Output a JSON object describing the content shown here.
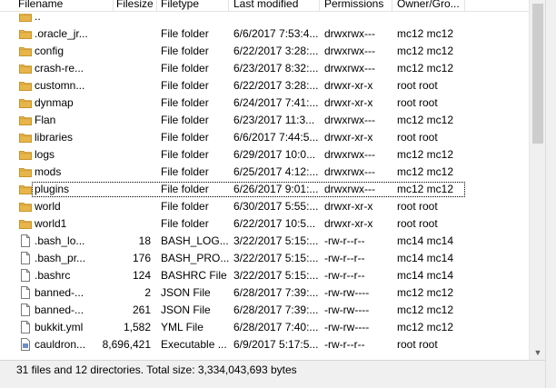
{
  "columns": {
    "filename": "Filename",
    "filesize": "Filesize",
    "filetype": "Filetype",
    "last_modified": "Last modified",
    "permissions": "Permissions",
    "owner": "Owner/Gro..."
  },
  "rows": [
    {
      "name": "..",
      "size": "",
      "type": "",
      "modified": "",
      "perm": "",
      "owner": "",
      "icon": "folder-icon"
    },
    {
      "name": ".oracle_jr...",
      "size": "",
      "type": "File folder",
      "modified": "6/6/2017 7:53:4...",
      "perm": "drwxrwx---",
      "owner": "mc12 mc12",
      "icon": "folder-icon"
    },
    {
      "name": "config",
      "size": "",
      "type": "File folder",
      "modified": "6/22/2017 3:28:...",
      "perm": "drwxrwx---",
      "owner": "mc12 mc12",
      "icon": "folder-icon"
    },
    {
      "name": "crash-re...",
      "size": "",
      "type": "File folder",
      "modified": "6/23/2017 8:32:...",
      "perm": "drwxrwx---",
      "owner": "mc12 mc12",
      "icon": "folder-icon"
    },
    {
      "name": "customn...",
      "size": "",
      "type": "File folder",
      "modified": "6/22/2017 3:28:...",
      "perm": "drwxr-xr-x",
      "owner": "root root",
      "icon": "folder-icon"
    },
    {
      "name": "dynmap",
      "size": "",
      "type": "File folder",
      "modified": "6/24/2017 7:41:...",
      "perm": "drwxr-xr-x",
      "owner": "root root",
      "icon": "folder-icon"
    },
    {
      "name": "Flan",
      "size": "",
      "type": "File folder",
      "modified": "6/23/2017 11:3...",
      "perm": "drwxrwx---",
      "owner": "mc12 mc12",
      "icon": "folder-icon"
    },
    {
      "name": "libraries",
      "size": "",
      "type": "File folder",
      "modified": "6/6/2017 7:44:5...",
      "perm": "drwxr-xr-x",
      "owner": "root root",
      "icon": "folder-icon"
    },
    {
      "name": "logs",
      "size": "",
      "type": "File folder",
      "modified": "6/29/2017 10:0...",
      "perm": "drwxrwx---",
      "owner": "mc12 mc12",
      "icon": "folder-icon"
    },
    {
      "name": "mods",
      "size": "",
      "type": "File folder",
      "modified": "6/25/2017 4:12:...",
      "perm": "drwxrwx---",
      "owner": "mc12 mc12",
      "icon": "folder-icon"
    },
    {
      "name": "plugins",
      "size": "",
      "type": "File folder",
      "modified": "6/26/2017 9:01:...",
      "perm": "drwxrwx---",
      "owner": "mc12 mc12",
      "icon": "folder-icon",
      "focused": true
    },
    {
      "name": "world",
      "size": "",
      "type": "File folder",
      "modified": "6/30/2017 5:55:...",
      "perm": "drwxr-xr-x",
      "owner": "root root",
      "icon": "folder-icon"
    },
    {
      "name": "world1",
      "size": "",
      "type": "File folder",
      "modified": "6/22/2017 10:5...",
      "perm": "drwxr-xr-x",
      "owner": "root root",
      "icon": "folder-icon"
    },
    {
      "name": ".bash_lo...",
      "size": "18",
      "type": "BASH_LOG...",
      "modified": "3/22/2017 5:15:...",
      "perm": "-rw-r--r--",
      "owner": "mc14 mc14",
      "icon": "file-icon"
    },
    {
      "name": ".bash_pr...",
      "size": "176",
      "type": "BASH_PRO...",
      "modified": "3/22/2017 5:15:...",
      "perm": "-rw-r--r--",
      "owner": "mc14 mc14",
      "icon": "file-icon"
    },
    {
      "name": ".bashrc",
      "size": "124",
      "type": "BASHRC File",
      "modified": "3/22/2017 5:15:...",
      "perm": "-rw-r--r--",
      "owner": "mc14 mc14",
      "icon": "file-icon"
    },
    {
      "name": "banned-...",
      "size": "2",
      "type": "JSON File",
      "modified": "6/28/2017 7:39:...",
      "perm": "-rw-rw----",
      "owner": "mc12 mc12",
      "icon": "file-icon"
    },
    {
      "name": "banned-...",
      "size": "261",
      "type": "JSON File",
      "modified": "6/28/2017 7:39:...",
      "perm": "-rw-rw----",
      "owner": "mc12 mc12",
      "icon": "file-icon"
    },
    {
      "name": "bukkit.yml",
      "size": "1,582",
      "type": "YML File",
      "modified": "6/28/2017 7:40:...",
      "perm": "-rw-rw----",
      "owner": "mc12 mc12",
      "icon": "file-icon"
    },
    {
      "name": "cauldron...",
      "size": "8,696,421",
      "type": "Executable ...",
      "modified": "6/9/2017 5:17:5...",
      "perm": "-rw-r--r--",
      "owner": "root root",
      "icon": "executable-file-icon"
    }
  ],
  "status": {
    "summary": "31 files and 12 directories. Total size: 3,334,043,693 bytes"
  },
  "colors": {
    "folder": "#e8b54a",
    "folder_dark": "#c9952c",
    "selection_outline": "#000000"
  }
}
